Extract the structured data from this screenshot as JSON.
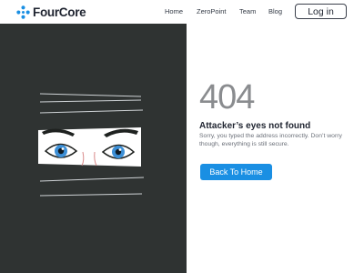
{
  "brand": {
    "name": "FourCore",
    "logo_icon": "diamond-dots-icon",
    "accent_color": "#1a8fe3"
  },
  "nav": {
    "links": [
      "Home",
      "ZeroPoint",
      "Team",
      "Blog"
    ],
    "login_label": "Log in"
  },
  "error": {
    "code": "404",
    "heading": "Attacker’s eyes not found",
    "message": "Sorry, you typed the address incorrectly. Don’t worry though, everything is still secure.",
    "button_label": "Back To Home",
    "button_color": "#1a8fe3"
  },
  "illustration": {
    "subject": "eyes-peeking-through-blinds-icon",
    "panel_color": "#2f3332"
  }
}
